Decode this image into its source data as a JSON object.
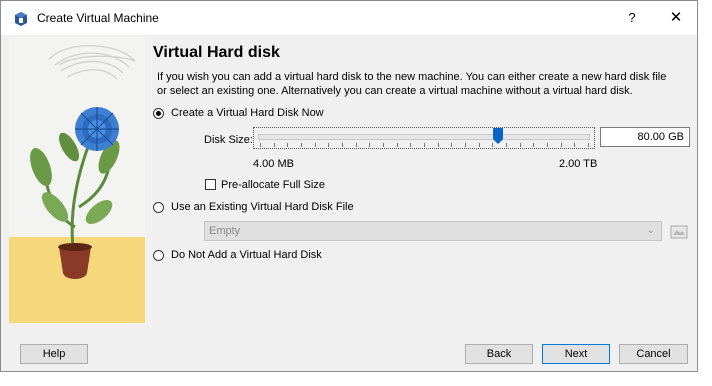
{
  "window": {
    "title": "Create Virtual Machine",
    "help_glyph": "?",
    "close_glyph": "✕"
  },
  "page": {
    "heading": "Virtual Hard disk",
    "description": "If you wish you can add a virtual hard disk to the new machine. You can either create a new hard disk file or select an existing one. Alternatively you can create a virtual machine without a virtual hard disk."
  },
  "options": {
    "create_now": {
      "label": "Create a Virtual Hard Disk Now",
      "selected": true
    },
    "use_existing": {
      "label": "Use an Existing Virtual Hard Disk File",
      "selected": false
    },
    "no_disk": {
      "label": "Do Not Add a Virtual Hard Disk",
      "selected": false
    }
  },
  "disk_size": {
    "label": "Disk Size:",
    "value": "80.00 GB",
    "min_label": "4.00 MB",
    "max_label": "2.00 TB",
    "slider_position": 0.73
  },
  "preallocate": {
    "label": "Pre-allocate Full Size",
    "checked": false
  },
  "existing_file": {
    "selected": "Empty"
  },
  "buttons": {
    "help": "Help",
    "back": "Back",
    "next": "Next",
    "cancel": "Cancel"
  },
  "colors": {
    "accent": "#0a64c8",
    "dialog_bg": "#f0f0f0"
  }
}
